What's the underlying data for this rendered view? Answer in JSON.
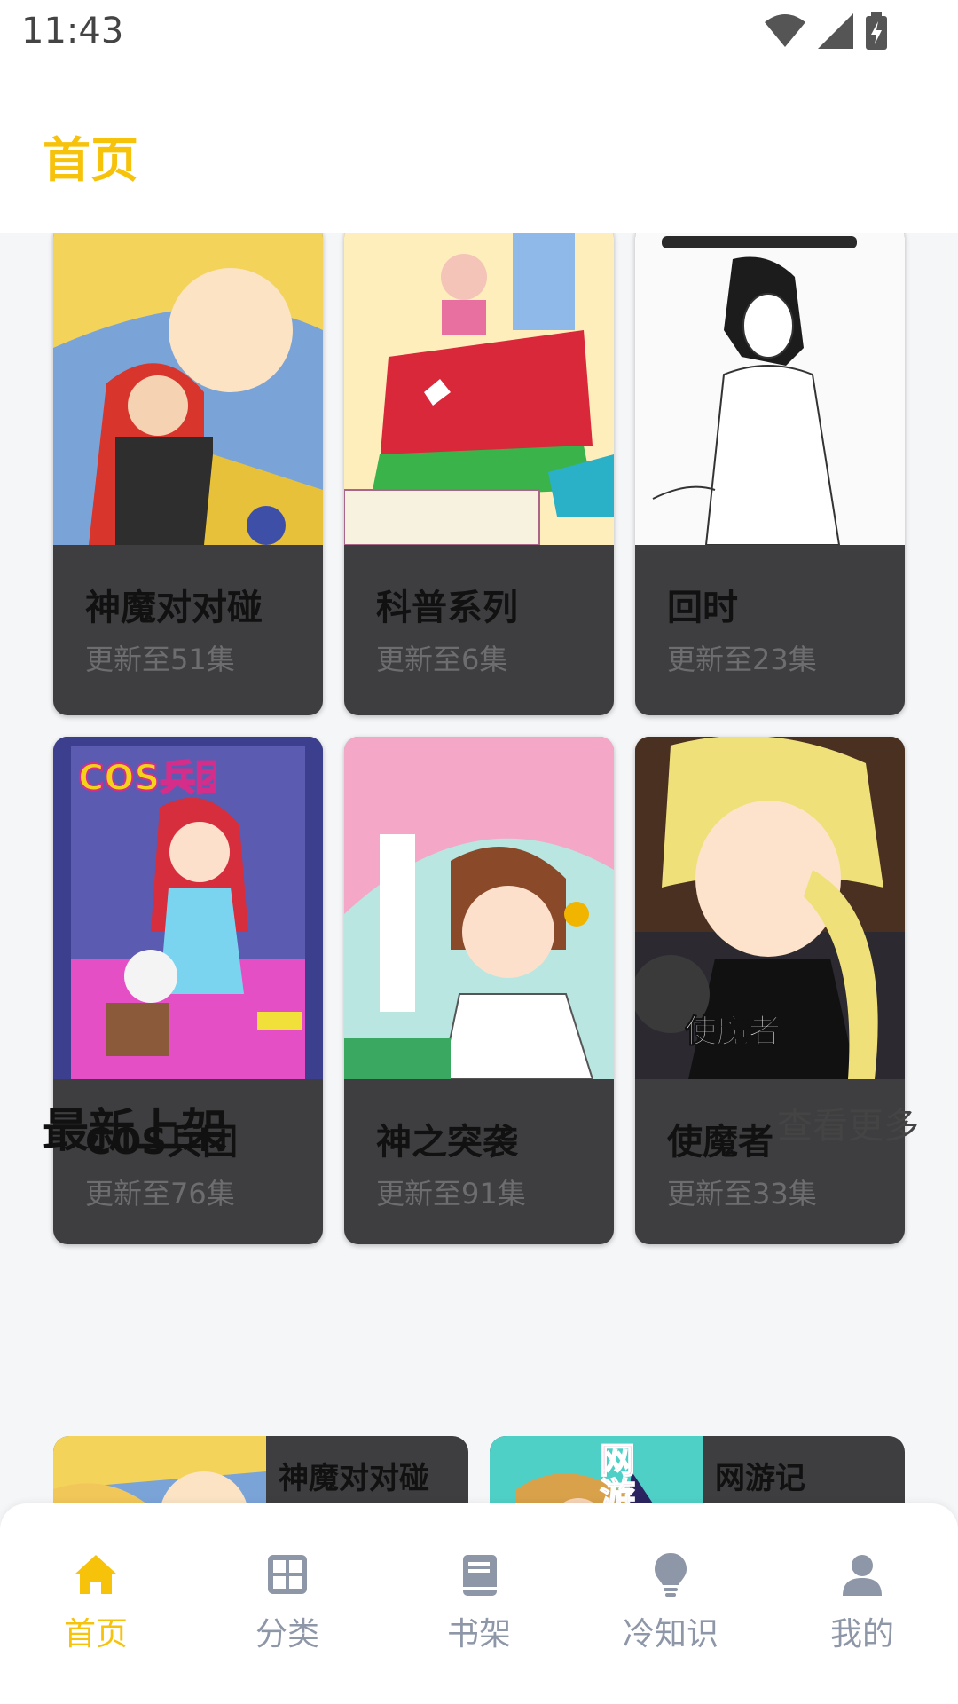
{
  "status": {
    "time": "11:43"
  },
  "header": {
    "title": "首页"
  },
  "grid": [
    {
      "title": "神魔对对碰",
      "subtitle": "更新至51集"
    },
    {
      "title": "科普系列",
      "subtitle": "更新至6集"
    },
    {
      "title": "回时",
      "subtitle": "更新至23集"
    },
    {
      "title": "COS兵团",
      "subtitle": "更新至76集"
    },
    {
      "title": "神之突袭",
      "subtitle": "更新至91集"
    },
    {
      "title": "使魔者",
      "subtitle": "更新至33集"
    }
  ],
  "cover_badges": {
    "cos": "COS兵团",
    "shimozhe": "使魔者",
    "wangyou": "网游"
  },
  "latest": {
    "title": "最新上架",
    "more": "查看更多",
    "items": [
      {
        "title": "神魔对对碰"
      },
      {
        "title": "网游记"
      }
    ]
  },
  "nav": {
    "items": [
      {
        "label": "首页",
        "icon": "home-icon",
        "active": true
      },
      {
        "label": "分类",
        "icon": "grid-icon",
        "active": false
      },
      {
        "label": "书架",
        "icon": "book-icon",
        "active": false
      },
      {
        "label": "冷知识",
        "icon": "bulb-icon",
        "active": false
      },
      {
        "label": "我的",
        "icon": "person-icon",
        "active": false
      }
    ]
  },
  "colors": {
    "accent": "#f7c20a",
    "card_bg": "#3e3e40",
    "nav_inactive": "#8e97a8"
  }
}
